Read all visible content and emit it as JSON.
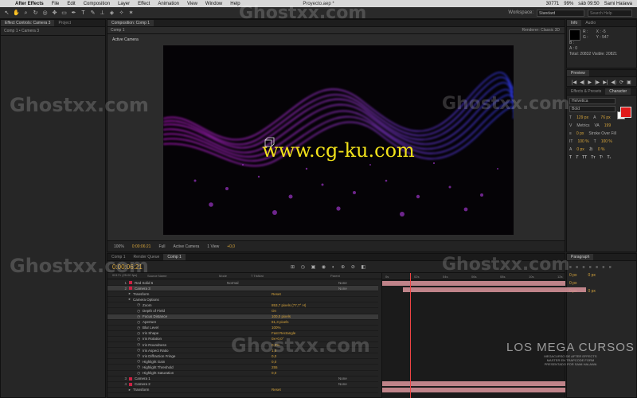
{
  "menubar": {
    "items": [
      "After Effects",
      "File",
      "Edit",
      "Composition",
      "Layer",
      "Effect",
      "Animation",
      "View",
      "Window",
      "Help"
    ],
    "doc_title": "Proyecto.aep *",
    "status": {
      "memory": "30771",
      "battery": "99%",
      "clock": "sáb 09:50",
      "user": "Sami Halawa"
    }
  },
  "toolbar": {
    "workspace_label": "Workspace:",
    "workspace_value": "Standard",
    "search_placeholder": "Search Help"
  },
  "left_panel": {
    "tabs": [
      "Effect Controls: Camera 3",
      "Project"
    ],
    "subtitle": "Comp 1 • Camera 3"
  },
  "composition": {
    "tab": "Composition: Comp 1",
    "subtab": "Comp 1",
    "renderer_label": "Renderer:",
    "renderer_value": "Classic 3D",
    "active_camera": "Active Camera",
    "overlay_text": "www.cg-ku.com",
    "controls": [
      "100%",
      "0:00:06:21",
      "Full",
      "Active Camera",
      "1 View",
      "+0,0"
    ]
  },
  "info": {
    "tabs": [
      "Info",
      "Audio"
    ],
    "lines": [
      "R :",
      "G :",
      "B :",
      "A : 0"
    ],
    "coords": [
      "X : -5",
      "Y : 547"
    ],
    "totals": "Total: 20832   Visible: 20821"
  },
  "preview": {
    "tab": "Preview",
    "buttons": [
      "|◀",
      "◀|",
      "▶",
      "|▶",
      "▶|",
      "◀)",
      "⟳",
      "▣"
    ]
  },
  "character": {
    "tabs": [
      "Effects & Presets",
      "Character"
    ],
    "font": "Helvetica",
    "style": "Bold",
    "size": "129 px",
    "leading": "76 px",
    "kerning": "Metrics",
    "tracking": "199",
    "stroke_width": "0 px",
    "stroke_type": "Stroke Over Fill",
    "vscale": "100 %",
    "hscale": "100 %",
    "baseline": "0 px",
    "tsume": "0 %"
  },
  "paragraph": {
    "tab": "Paragraph",
    "indents": [
      "0 px",
      "0 px",
      "0 px",
      "0 px",
      "0 px"
    ]
  },
  "timeline": {
    "tabs": [
      "Comp 1",
      "Render Queue",
      "Comp 1"
    ],
    "timecode": "0:00:06:21",
    "fps": "00171 (25.00 fps)",
    "columns": [
      "Source Name",
      "Mode",
      "T TrkMat",
      "Parent"
    ],
    "layers": [
      {
        "num": "1",
        "name": "Red Solid 6",
        "mode": "Normal",
        "parent": "None",
        "kind": "layer"
      },
      {
        "num": "2",
        "name": "Camera 3",
        "parent": "None",
        "kind": "layer",
        "selected": true
      },
      {
        "name": "Transform",
        "value": "Reset",
        "kind": "group"
      },
      {
        "name": "Camera Options",
        "kind": "group"
      },
      {
        "name": "Zoom",
        "value": "853,7 pixels (77,7° H)",
        "kind": "prop"
      },
      {
        "name": "Depth of Field",
        "value": "On",
        "kind": "prop"
      },
      {
        "name": "Focus Distance",
        "value": "100,0 pixels",
        "kind": "prop",
        "selected": true
      },
      {
        "name": "Aperture",
        "value": "81,3 pixels",
        "kind": "prop"
      },
      {
        "name": "Blur Level",
        "value": "100%",
        "kind": "prop"
      },
      {
        "name": "Iris Shape",
        "value": "Fast Rectangle",
        "kind": "prop"
      },
      {
        "name": "Iris Rotation",
        "value": "0x+0,0°",
        "kind": "prop"
      },
      {
        "name": "Iris Roundness",
        "value": "0,0%",
        "kind": "prop"
      },
      {
        "name": "Iris Aspect Ratio",
        "value": "1,0",
        "kind": "prop"
      },
      {
        "name": "Iris Diffraction Fringe",
        "value": "0,0",
        "kind": "prop"
      },
      {
        "name": "Highlight Gain",
        "value": "0,0",
        "kind": "prop"
      },
      {
        "name": "Highlight Threshold",
        "value": "255",
        "kind": "prop"
      },
      {
        "name": "Highlight Saturation",
        "value": "0,0",
        "kind": "prop"
      },
      {
        "num": "3",
        "name": "Camera 1",
        "parent": "None",
        "kind": "layer"
      },
      {
        "num": "4",
        "name": "Camera 2",
        "parent": "None",
        "kind": "layer"
      },
      {
        "name": "Transform",
        "value": "Reset",
        "kind": "group"
      }
    ],
    "ruler_labels": [
      "0s",
      "02s",
      "04s",
      "06s",
      "08s",
      "10s",
      "12s"
    ]
  },
  "watermark": {
    "text": "Ghostxx.com",
    "brand_big": "LOS MEGA CURSOS",
    "brand_lines": [
      "MEGACURSO DE AFTER EFFECTS",
      "MASTER EN TRAPCODE FORM",
      "PRESENTADO POR SAMI HALAWA"
    ]
  },
  "colors": {
    "accent": "#d6a43b",
    "label_red": "#cc2244",
    "bar_pink": "#d28f96",
    "viewer_bg": "#050306"
  }
}
